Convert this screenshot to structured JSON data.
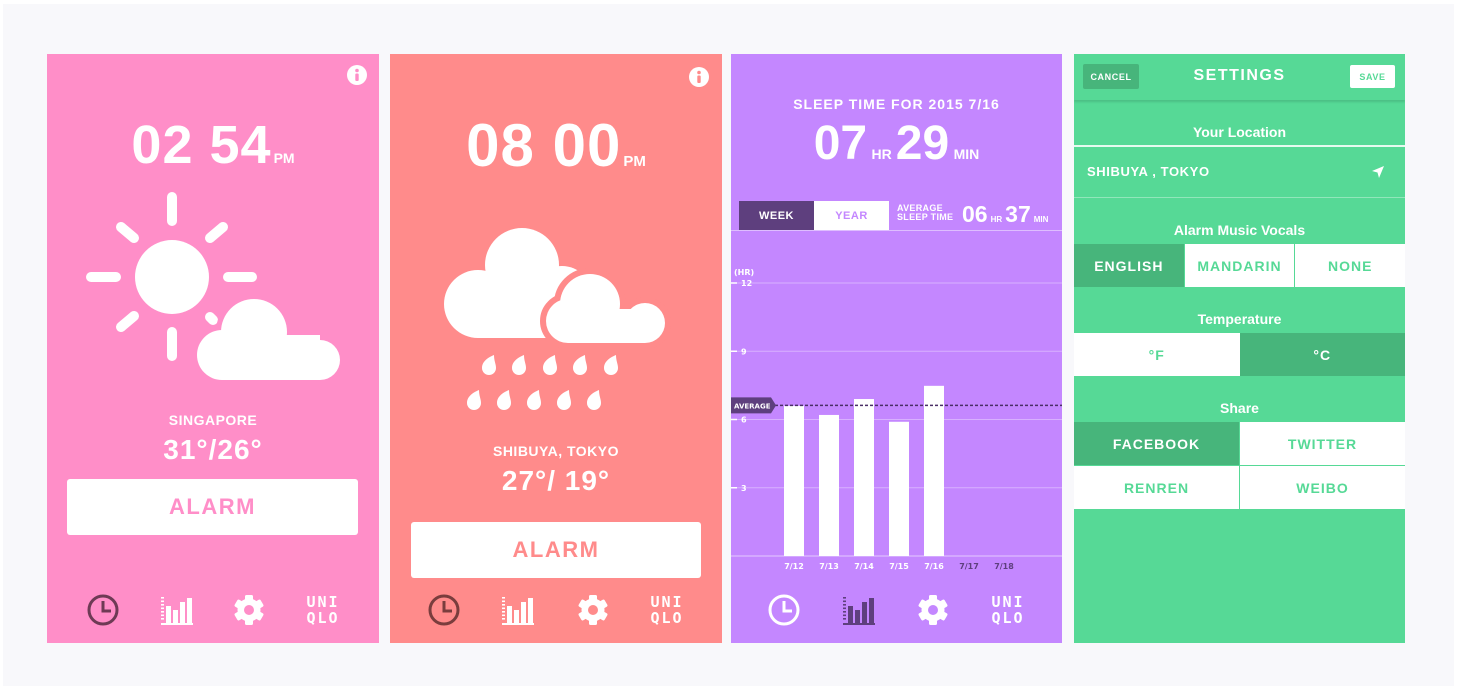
{
  "colors": {
    "pink": "#ff8ec8",
    "coral": "#ff8b8b",
    "purple": "#c487ff",
    "purple_dark": "#5e3f7e",
    "green": "#56d996",
    "green_dark": "#47b57b",
    "pink_icon_dark": "#6e3a55",
    "coral_icon_dark": "#7a3d3d"
  },
  "weather_clear": {
    "time": "02 54",
    "ampm": "PM",
    "weather_icon": "partly-sunny-icon",
    "city": "SINGAPORE",
    "temps": "31°/26°",
    "alarm_label": "ALARM"
  },
  "weather_rain": {
    "time": "08 00",
    "ampm": "PM",
    "weather_icon": "rain-icon",
    "city": "SHIBUYA, TOKYO",
    "temps": "27°/ 19°",
    "alarm_label": "ALARM"
  },
  "nav": {
    "items": [
      {
        "icon": "clock-icon"
      },
      {
        "icon": "bar-chart-icon"
      },
      {
        "icon": "gear-icon"
      },
      {
        "icon": "uniqlo-logo",
        "line1": "UNI",
        "line2": "QLO"
      }
    ]
  },
  "sleep": {
    "title": "SLEEP TIME FOR 2015 7/16",
    "hours": "07",
    "hr_unit": "HR",
    "minutes": "29",
    "min_unit": "MIN",
    "tabs": [
      {
        "label": "WEEK",
        "active": true
      },
      {
        "label": "YEAR",
        "active": false
      }
    ],
    "average_line1": "AVERAGE",
    "average_line2": "SLEEP TIME",
    "avg_hours": "06",
    "avg_hr_unit": "HR",
    "avg_minutes": "37",
    "avg_min_unit": "MIN"
  },
  "chart_data": {
    "type": "bar",
    "title": "SLEEP TIME FOR 2015 7/16",
    "xlabel": "",
    "ylabel": "(HR)",
    "categories": [
      "7/12",
      "7/13",
      "7/14",
      "7/15",
      "7/16",
      "7/17",
      "7/18"
    ],
    "values": [
      6.6,
      6.2,
      6.9,
      5.9,
      7.48,
      null,
      null
    ],
    "ylim": [
      0,
      12
    ],
    "yticks": [
      3,
      6,
      9,
      12
    ],
    "grid": true,
    "average": 6.62,
    "average_label": "AVERAGE"
  },
  "settings": {
    "title": "SETTINGS",
    "cancel_label": "CANCEL",
    "save_label": "SAVE",
    "location_heading": "Your Location",
    "location_value": "SHIBUYA , TOKYO",
    "vocals_heading": "Alarm Music Vocals",
    "vocals_options": [
      {
        "label": "ENGLISH",
        "selected": true
      },
      {
        "label": "MANDARIN",
        "selected": false
      },
      {
        "label": "NONE",
        "selected": false
      }
    ],
    "temperature_heading": "Temperature",
    "temperature_options": [
      {
        "label": "°F",
        "selected": false
      },
      {
        "label": "°C",
        "selected": true
      }
    ],
    "share_heading": "Share",
    "share_options": [
      {
        "label": "FACEBOOK",
        "selected": true
      },
      {
        "label": "TWITTER",
        "selected": false
      },
      {
        "label": "RENREN",
        "selected": false
      },
      {
        "label": "WEIBO",
        "selected": false
      }
    ]
  }
}
